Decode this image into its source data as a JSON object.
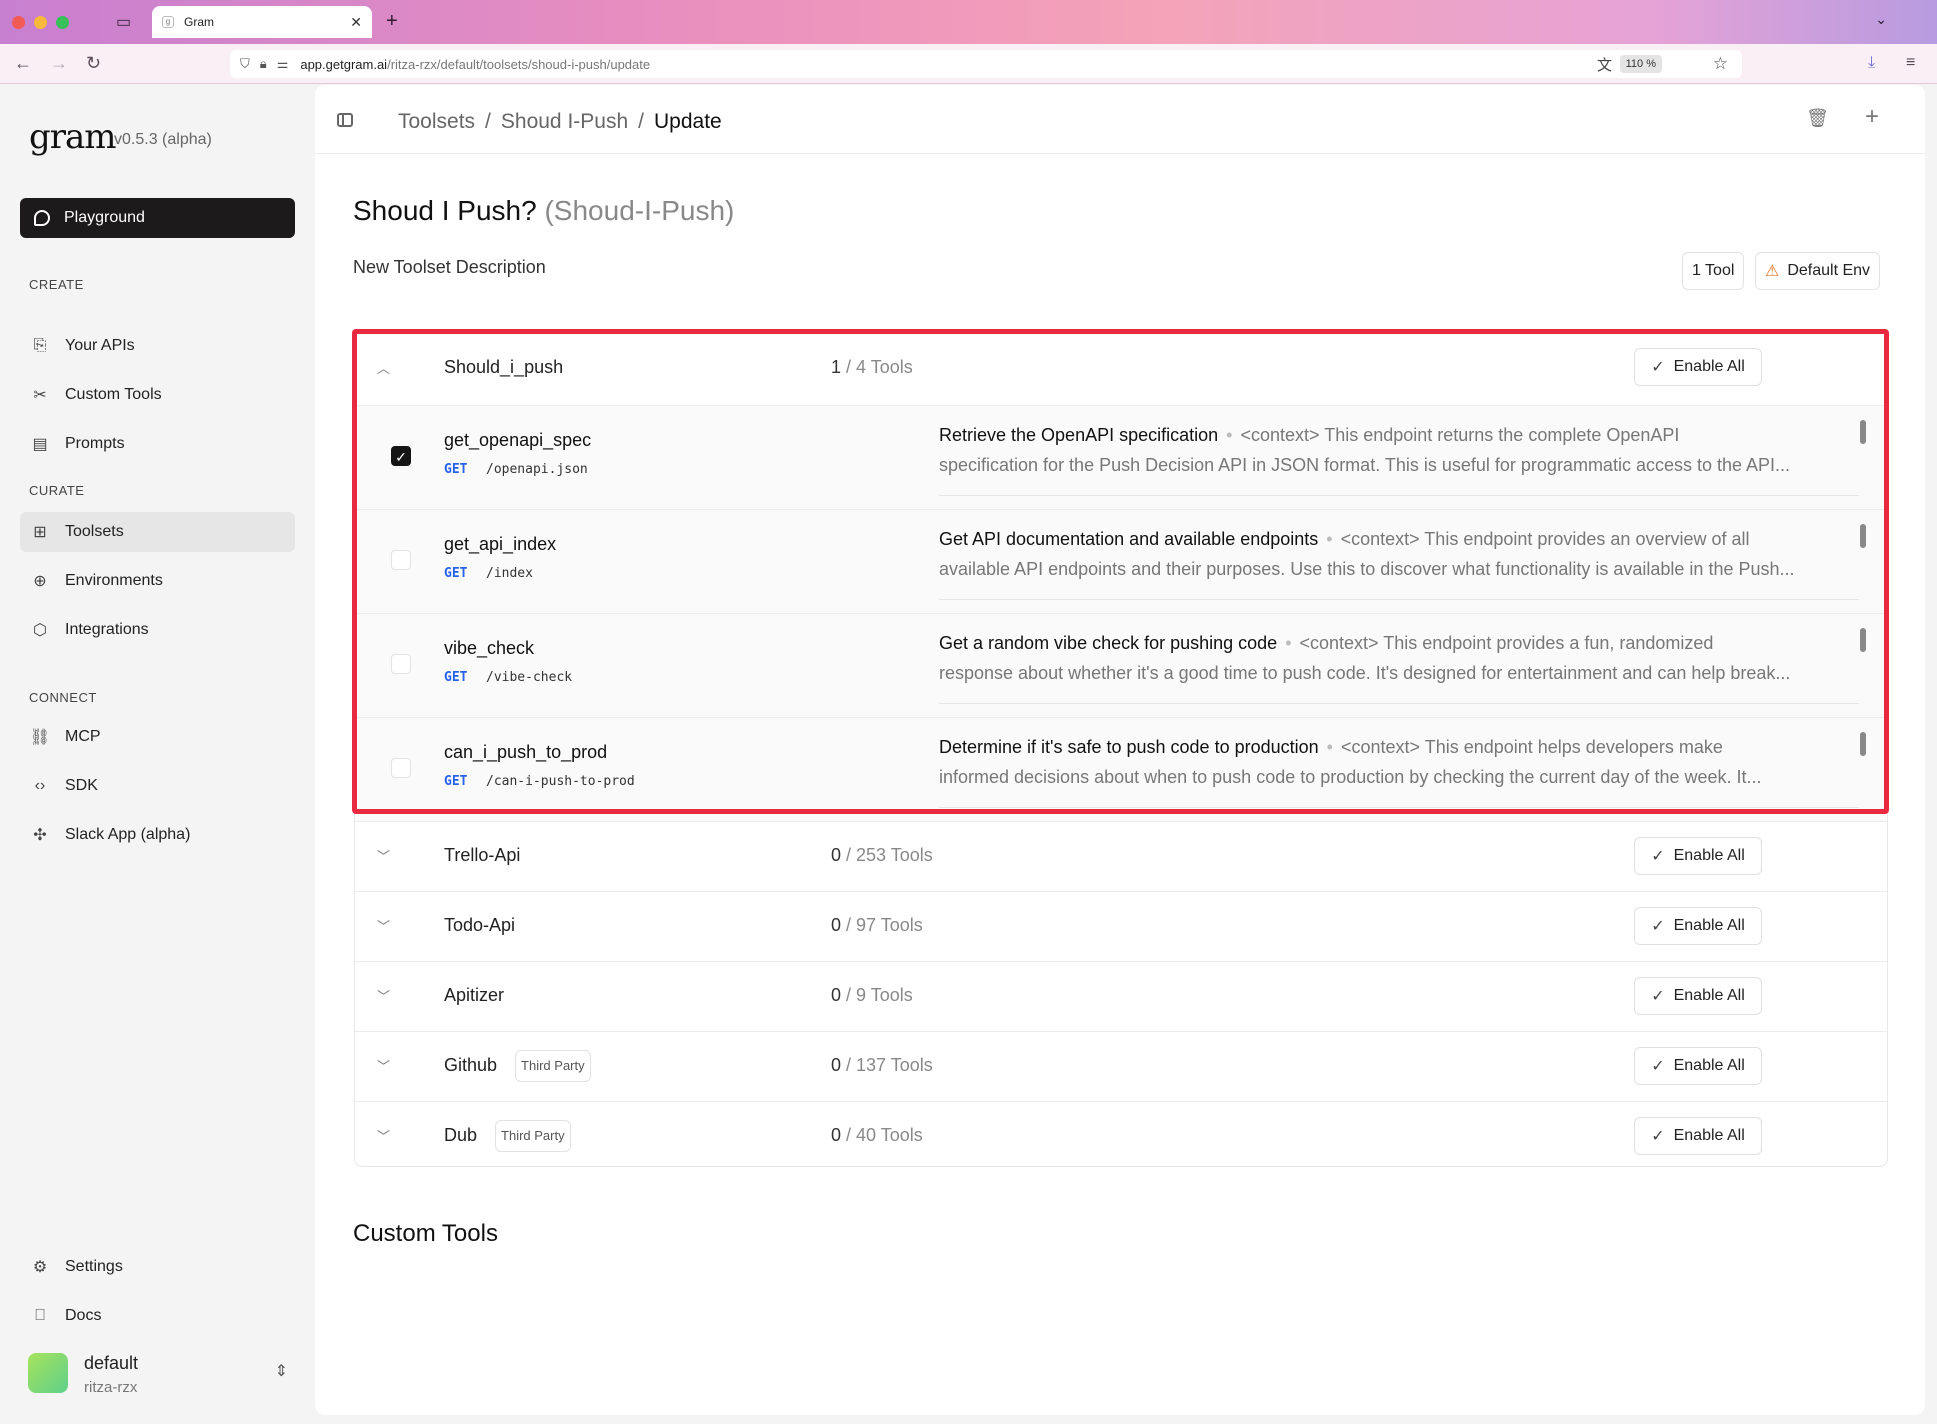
{
  "browser": {
    "tab_title": "Gram",
    "url_host": "app.getgram.ai",
    "url_path": "/ritza-rzx/default/toolsets/shoud-i-push/update",
    "zoom": "110 %"
  },
  "sidebar": {
    "logo": "gram",
    "version": "v0.5.3 (alpha)",
    "playground": "Playground",
    "sections": {
      "create": "CREATE",
      "curate": "CURATE",
      "connect": "CONNECT"
    },
    "create_items": [
      "Your APIs",
      "Custom Tools",
      "Prompts"
    ],
    "curate_items": [
      "Toolsets",
      "Environments",
      "Integrations"
    ],
    "connect_items": [
      "MCP",
      "SDK",
      "Slack App (alpha)"
    ],
    "bottom_items": [
      "Settings",
      "Docs"
    ],
    "workspace": {
      "name": "default",
      "org": "ritza-rzx"
    }
  },
  "header": {
    "breadcrumb": [
      "Toolsets",
      "Shoud I-Push",
      "Update"
    ]
  },
  "toolset": {
    "title": "Shoud I Push?",
    "slug": "(Shoud-I-Push)",
    "description": "New Toolset Description",
    "tool_count": "1 Tool",
    "env": "Default Env"
  },
  "enable_all_label": "Enable All",
  "sources": [
    {
      "name": "Should_i_push",
      "enabled": "1",
      "total": "/ 4 Tools",
      "badge": ""
    },
    {
      "name": "Trello-Api",
      "enabled": "0",
      "total": "/ 253 Tools",
      "badge": ""
    },
    {
      "name": "Todo-Api",
      "enabled": "0",
      "total": "/ 97 Tools",
      "badge": ""
    },
    {
      "name": "Apitizer",
      "enabled": "0",
      "total": "/ 9 Tools",
      "badge": ""
    },
    {
      "name": "Github",
      "enabled": "0",
      "total": "/ 137 Tools",
      "badge": "Third Party"
    },
    {
      "name": "Dub",
      "enabled": "0",
      "total": "/ 40 Tools",
      "badge": "Third Party"
    }
  ],
  "tools": [
    {
      "name": "get_openapi_spec",
      "method": "GET",
      "path": "/openapi.json",
      "checked": true,
      "summary": "Retrieve the OpenAPI specification",
      "context_line1": "<context> This endpoint returns the complete OpenAPI",
      "context_line2": "specification for the Push Decision API in JSON format. This is useful for programmatic access to the API..."
    },
    {
      "name": "get_api_index",
      "method": "GET",
      "path": "/index",
      "checked": false,
      "summary": "Get API documentation and available endpoints",
      "context_line1": "<context> This endpoint provides an overview of all",
      "context_line2": "available API endpoints and their purposes. Use this to discover what functionality is available in the Push..."
    },
    {
      "name": "vibe_check",
      "method": "GET",
      "path": "/vibe-check",
      "checked": false,
      "summary": "Get a random vibe check for pushing code",
      "context_line1": "<context> This endpoint provides a fun, randomized",
      "context_line2": "response about whether it's a good time to push code. It's designed for entertainment and can help break..."
    },
    {
      "name": "can_i_push_to_prod",
      "method": "GET",
      "path": "/can-i-push-to-prod",
      "checked": false,
      "summary": "Determine if it's safe to push code to production",
      "context_line1": "<context> This endpoint helps developers make",
      "context_line2": "informed decisions about when to push code to production by checking the current day of the week. It..."
    }
  ],
  "custom_tools_heading": "Custom Tools",
  "colors": {
    "highlight": "#e8293e",
    "method": "#2563eb",
    "primary_button": "#1c1a1a"
  }
}
